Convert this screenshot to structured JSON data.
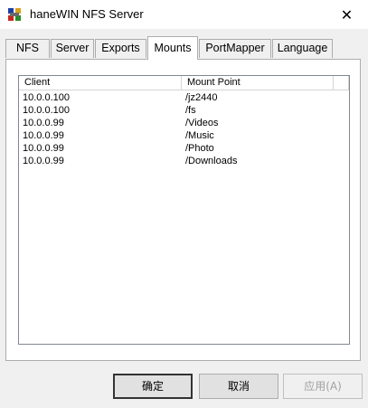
{
  "window": {
    "title": "haneWIN NFS Server",
    "close_glyph": "✕"
  },
  "tabs": [
    {
      "label": "NFS",
      "active": false
    },
    {
      "label": "Server",
      "active": false
    },
    {
      "label": "Exports",
      "active": false
    },
    {
      "label": "Mounts",
      "active": true
    },
    {
      "label": "PortMapper",
      "active": false
    },
    {
      "label": "Language",
      "active": false
    }
  ],
  "mounts": {
    "columns": [
      "Client",
      "Mount Point"
    ],
    "rows": [
      {
        "client": "10.0.0.100",
        "mount_point": "/jz2440"
      },
      {
        "client": "10.0.0.100",
        "mount_point": "/fs"
      },
      {
        "client": "10.0.0.99",
        "mount_point": "/Videos"
      },
      {
        "client": "10.0.0.99",
        "mount_point": "/Music"
      },
      {
        "client": "10.0.0.99",
        "mount_point": "/Photo"
      },
      {
        "client": "10.0.0.99",
        "mount_point": "/Downloads"
      }
    ]
  },
  "footer": {
    "ok_label": "确定",
    "cancel_label": "取消",
    "apply_label": "应用(A)",
    "apply_enabled": false
  },
  "colors": {
    "window_bg": "#f0f0f0",
    "panel_bg": "#ffffff",
    "border": "#adadad"
  }
}
